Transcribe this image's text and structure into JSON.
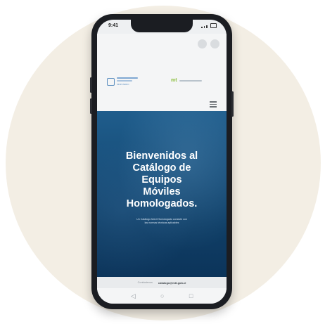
{
  "status_bar": {
    "time": "9:41",
    "icons": [
      "signal-icon",
      "wifi-icon",
      "battery-icon"
    ]
  },
  "browser": {
    "actions": [
      "browser-action-icon",
      "browser-action-icon"
    ]
  },
  "header": {
    "logo_left_text": "MINISTERIO",
    "logo_right_mark": "mt",
    "menu_icon": "hamburger-menu-icon"
  },
  "hero": {
    "title_lines": [
      "Bienvenidos al",
      "Catálogo de",
      "Equipos",
      "Móviles",
      "Homologados."
    ],
    "subtitle_lines": [
      "Un Catálogo Móvil Homologado consiste con",
      "las normas técnicas aplicables"
    ]
  },
  "footer": {
    "label": "Contáctenos",
    "email": "catalogo@mtt.gob.cl"
  },
  "nav": {
    "icons": [
      "back-triangle-icon",
      "home-circle-icon",
      "recent-square-icon"
    ]
  },
  "colors": {
    "background_circle": "#f3eee4",
    "hero_blue": "#154a75",
    "accent_green": "#8cbf3f"
  }
}
